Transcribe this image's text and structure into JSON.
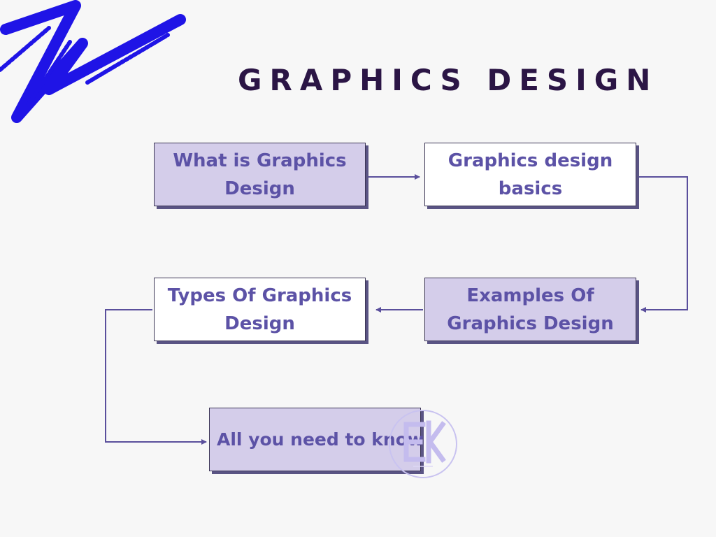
{
  "title": "GRAPHICS DESIGN",
  "colors": {
    "background": "#f7f7f7",
    "title": "#2b1545",
    "box_fill_purple": "#d4cdea",
    "box_fill_white": "#ffffff",
    "box_text": "#5c52a6",
    "connector": "#5a4f9c",
    "brush_stroke": "#1f14e6"
  },
  "flowchart": {
    "steps": [
      {
        "id": "what",
        "label": "What is Graphics Design",
        "fill": "purple"
      },
      {
        "id": "basics",
        "label": "Graphics design basics",
        "fill": "white"
      },
      {
        "id": "examples",
        "label": "Examples Of Graphics Design",
        "fill": "purple"
      },
      {
        "id": "types",
        "label": "Types Of Graphics Design",
        "fill": "white"
      },
      {
        "id": "all",
        "label": "All you need to know",
        "fill": "purple"
      }
    ],
    "connections": [
      {
        "from": "what",
        "to": "basics"
      },
      {
        "from": "basics",
        "to": "examples"
      },
      {
        "from": "examples",
        "to": "types"
      },
      {
        "from": "types",
        "to": "all"
      }
    ]
  },
  "decor": {
    "brush_stroke": "blue-brush-stroke",
    "watermark_icon": "ek-logo-icon"
  }
}
